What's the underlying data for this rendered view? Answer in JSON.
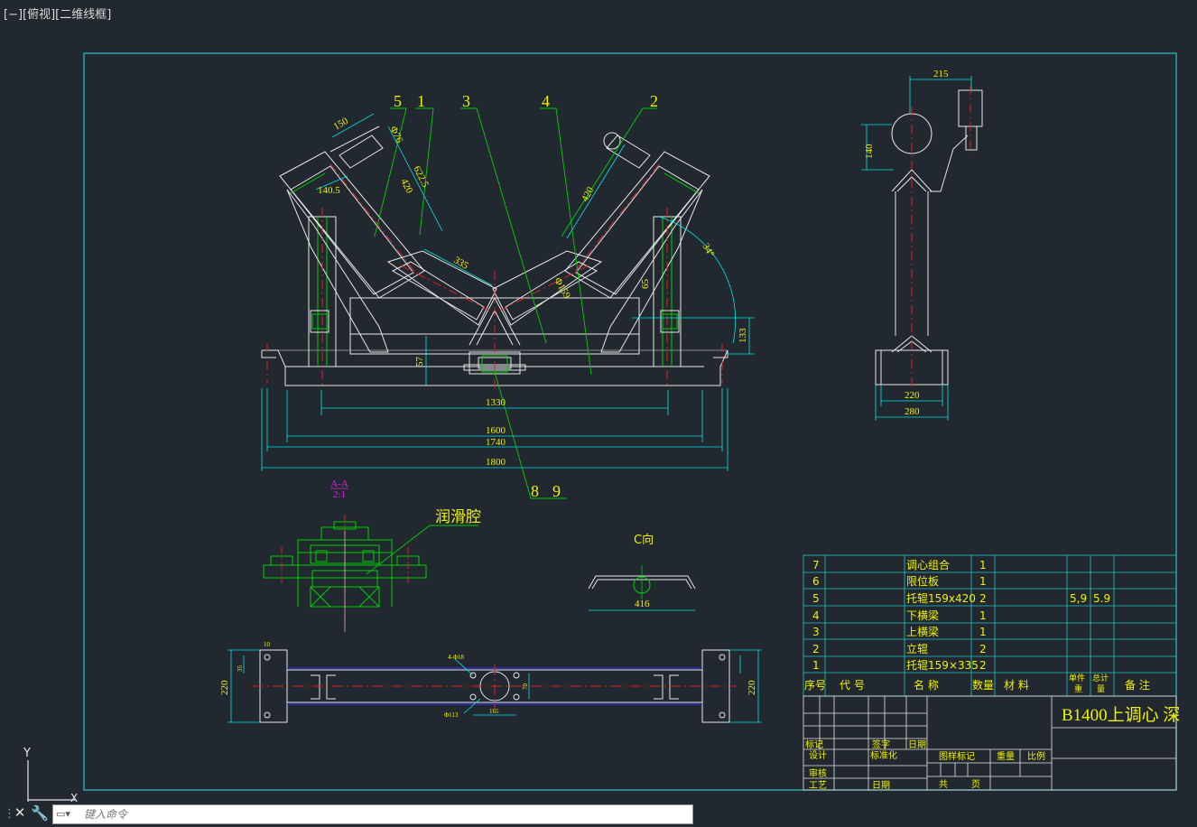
{
  "viewport": {
    "label": "[−][俯视][二维线框]"
  },
  "ucs": {
    "y_label": "Y",
    "x_label": "X"
  },
  "command_line": {
    "placeholder": "键入命令",
    "value": ""
  },
  "colors": {
    "background": "#212830",
    "frame": "#27c3c8",
    "dim": "#00e6e6",
    "label": "#f2f200",
    "leader": "#00d000",
    "center": "#e02020",
    "geom": "#e6e6e6",
    "section": "#e020e0",
    "hatch": "#3030c0"
  },
  "drawing": {
    "part_numbers": [
      "5",
      "1",
      "3",
      "4",
      "2",
      "8",
      "9"
    ],
    "front_dims": {
      "d150": "150",
      "d76": "Φ76",
      "d622": "622.5",
      "d420a": "420",
      "d1405": "140.5",
      "d335": "335",
      "d420b": "420",
      "d34": "34°",
      "d159": "Φ159",
      "d65": "65",
      "d133": "133",
      "d57": "57",
      "d1330": "1330",
      "d1600": "1600",
      "d1740": "1740",
      "d1800": "1800"
    },
    "side_dims": {
      "d215": "215",
      "d140": "140",
      "d220": "220",
      "d280": "280"
    },
    "section_label": {
      "line1": "A-A",
      "line2": "2:1"
    },
    "lube_label": "润滑腔",
    "c_view": {
      "title": "C向",
      "dim": "416"
    },
    "plan_dims": {
      "holes": "4-Φ18",
      "bore": "Φ113",
      "d165": "165",
      "d220l": "220",
      "d220r": "220",
      "d70": "70",
      "d35": "35",
      "d10": "10"
    }
  },
  "bom": {
    "rows": [
      {
        "no": "7",
        "name": "调心组合",
        "qty": "1",
        "unit_w": "",
        "total_w": ""
      },
      {
        "no": "6",
        "name": "限位板",
        "qty": "1",
        "unit_w": "",
        "total_w": ""
      },
      {
        "no": "5",
        "name": "托辊159x420",
        "qty": "2",
        "unit_w": "5,9",
        "total_w": "5.9"
      },
      {
        "no": "4",
        "name": "下横梁",
        "qty": "1",
        "unit_w": "",
        "total_w": ""
      },
      {
        "no": "3",
        "name": "上横梁",
        "qty": "1",
        "unit_w": "",
        "total_w": ""
      },
      {
        "no": "2",
        "name": "立辊",
        "qty": "2",
        "unit_w": "",
        "total_w": ""
      },
      {
        "no": "1",
        "name": "托辊159×335",
        "qty": "2",
        "unit_w": "",
        "total_w": ""
      }
    ],
    "header": {
      "no": "序号",
      "code": "代    号",
      "name": "名    称",
      "qty": "数量",
      "material": "材    料",
      "unit_w1": "单件",
      "unit_w2": "重",
      "total_w1": "总计",
      "total_w2": "量",
      "remark": "备    注"
    }
  },
  "title_block": {
    "drawing_title": "B1400上调心 深",
    "mark": "标记",
    "sign": "签字",
    "date": "日期",
    "design": "设计",
    "standard": "标准化",
    "review": "审核",
    "process": "工艺",
    "approve": "日期",
    "stage": "图样标记",
    "weight": "重量",
    "scale": "比例",
    "sheets": "共",
    "sheet": "页"
  }
}
